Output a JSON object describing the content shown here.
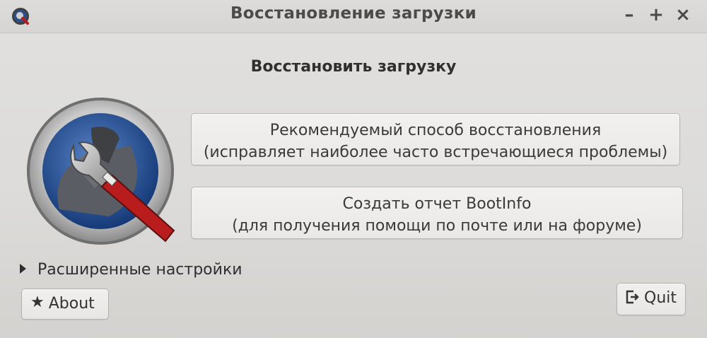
{
  "window": {
    "title": "Восстановление загрузки",
    "icon": "boot-repair-app-icon",
    "controls": {
      "minimize": "–",
      "maximize": "+",
      "close": "×"
    }
  },
  "main": {
    "heading": "Восстановить загрузку",
    "logo_icon": "wrench-repair-logo",
    "recommended": {
      "line1": "Рекомендуемый способ восстановления",
      "line2": "(исправляет наиболее часто встречающиеся проблемы)"
    },
    "bootinfo": {
      "line1": "Создать отчет BootInfo",
      "line2": "(для получения помощи по почте или на форуме)"
    },
    "advanced_label": "Расширенные настройки"
  },
  "footer": {
    "about_label": "About",
    "about_icon": "star-icon",
    "quit_label": "Quit",
    "quit_icon": "exit-icon"
  }
}
